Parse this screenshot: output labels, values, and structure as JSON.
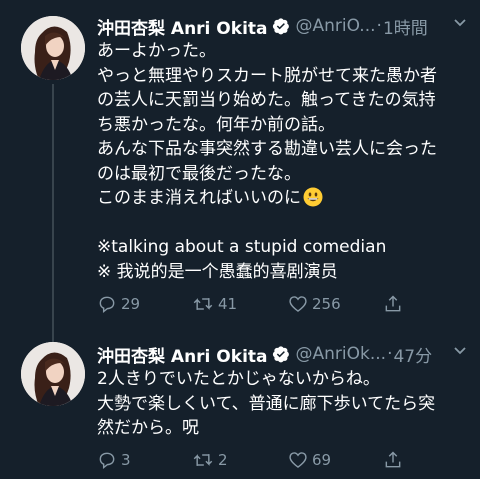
{
  "tweets": [
    {
      "name": "沖田杏梨 Anri Okita",
      "handle": "@AnriO...",
      "dot": "·",
      "time": "1時間",
      "lines": [
        "あーよかった。",
        "やっと無理やりスカート脱がせて来た愚か者",
        "の芸人に天罰当り始めた。触ってきたの気持",
        "ち悪かったな。何年か前の話。",
        "あんな下品な事突然する勘違い芸人に会った",
        "のは最初で最後だったな。",
        "このまま消えればいいのに"
      ],
      "extra_lines": [
        "※talking about a stupid comedian",
        "※ 我说的是一个愚蠢的喜剧演员"
      ],
      "replies": "29",
      "retweets": "41",
      "likes": "256"
    },
    {
      "name": "沖田杏梨 Anri Okita",
      "handle": "@AnriOk...",
      "dot": "·",
      "time": "47分",
      "lines": [
        "2人きりでいたとかじゃないからね。",
        "大勢で楽しくいて、普通に廊下歩いてたら突",
        "然だから。呪"
      ],
      "replies": "3",
      "retweets": "2",
      "likes": "69"
    }
  ],
  "colors": {
    "background": "#15202b",
    "text": "#ffffff",
    "muted": "#8899a6",
    "verified": "#ffffff",
    "thread_line": "#38444d"
  }
}
